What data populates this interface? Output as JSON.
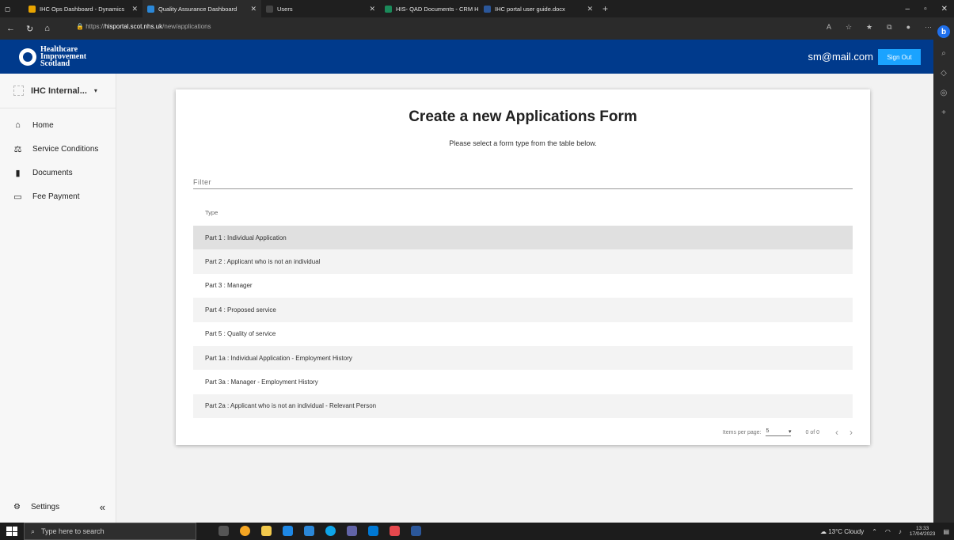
{
  "browser": {
    "tabs": [
      {
        "title": "IHC Ops Dashboard - Dynamics",
        "color": "#e8a400"
      },
      {
        "title": "Quality Assurance Dashboard",
        "color": "#2b88d8"
      },
      {
        "title": "Users",
        "color": "#444444"
      },
      {
        "title": "HIS- QAD Documents - CRM Hel",
        "color": "#1b8a5a"
      },
      {
        "title": "IHC portal user guide.docx",
        "color": "#2b579a"
      }
    ],
    "url_prefix": "https://",
    "url_host": "hisportal.scot.nhs.uk",
    "url_path": "/new/applications"
  },
  "header": {
    "org_line1": "Healthcare",
    "org_line2": "Improvement",
    "org_line3": "Scotland",
    "user_email": "sm@mail.com",
    "signout_label": "Sign Out",
    "brand_color": "#003a8c",
    "accent_color": "#1aa3ff"
  },
  "sidebar": {
    "org_selector": "IHC Internal...",
    "items": [
      {
        "label": "Home",
        "icon": "home-icon"
      },
      {
        "label": "Service Conditions",
        "icon": "gavel-icon"
      },
      {
        "label": "Documents",
        "icon": "document-icon"
      },
      {
        "label": "Fee Payment",
        "icon": "credit-card-icon"
      }
    ],
    "settings_label": "Settings"
  },
  "main": {
    "title": "Create a new Applications Form",
    "subtitle": "Please select a form type from the table below.",
    "filter_placeholder": "Filter",
    "column_header": "Type",
    "rows": [
      "Part 1 : Individual Application",
      "Part 2 : Applicant who is not an individual",
      "Part 3 : Manager",
      "Part 4 : Proposed service",
      "Part 5 : Quality of service",
      "Part 1a : Individual Application - Employment History",
      "Part 3a : Manager - Employment History",
      "Part 2a : Applicant who is not an individual - Relevant Person"
    ],
    "pager": {
      "items_per_page_label": "Items per page:",
      "items_per_page_value": "5",
      "range": "0 of 0"
    }
  },
  "taskbar": {
    "search_placeholder": "Type here to search",
    "weather": "13°C  Cloudy",
    "time": "13:33",
    "date": "17/04/2023"
  }
}
